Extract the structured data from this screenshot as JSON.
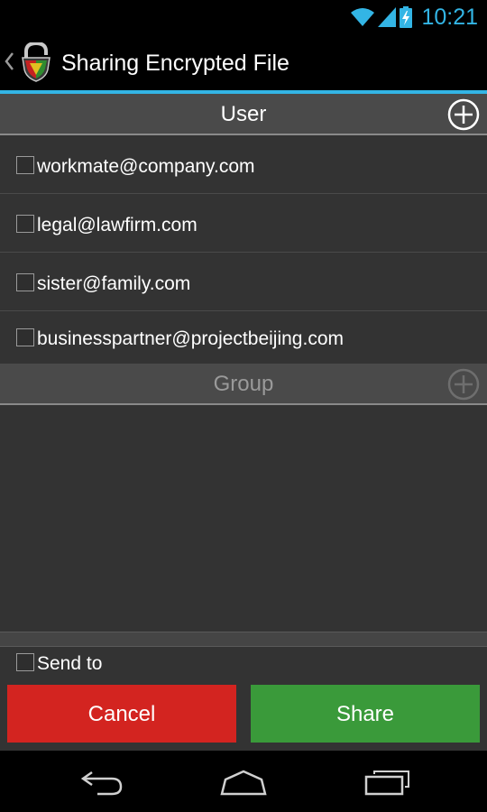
{
  "status_bar": {
    "time": "10:21"
  },
  "action_bar": {
    "title": "Sharing Encrypted File"
  },
  "user_section": {
    "header": "User",
    "users": [
      {
        "email": "workmate@company.com",
        "checked": false
      },
      {
        "email": "legal@lawfirm.com",
        "checked": false
      },
      {
        "email": "sister@family.com",
        "checked": false
      },
      {
        "email": "businesspartner@projectbeijing.com",
        "checked": false
      }
    ]
  },
  "group_section": {
    "header": "Group"
  },
  "send_to": {
    "label": "Send to",
    "checked": false
  },
  "buttons": {
    "cancel": "Cancel",
    "share": "Share"
  },
  "colors": {
    "accent": "#33b5e5",
    "cancel": "#d32420",
    "share": "#3a9a3a"
  },
  "icons": {
    "status": [
      "wifi-icon",
      "cell-signal-icon",
      "battery-charging-icon"
    ],
    "action_bar": [
      "up-chevron-icon",
      "lock-shield-app-icon"
    ],
    "nav": [
      "back-icon",
      "home-icon",
      "recent-apps-icon"
    ]
  }
}
